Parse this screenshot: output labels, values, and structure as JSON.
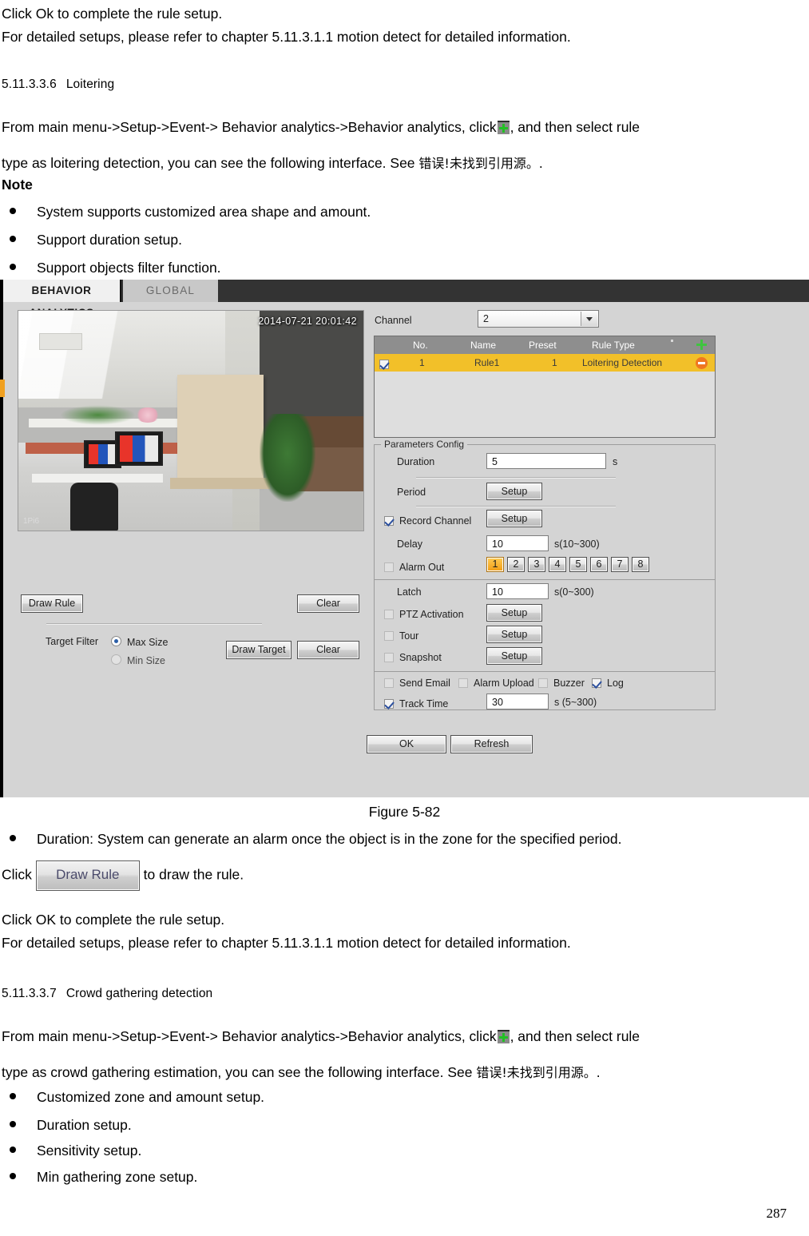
{
  "document": {
    "intro_lines": [
      "Click Ok to complete the rule setup.",
      "For detailed setups, please refer to chapter 5.11.3.1.1 motion detect for detailed information."
    ],
    "section1": {
      "number": "5.11.3.3.6",
      "title": "Loitering",
      "para_part1": "From main menu->Setup->Event-> Behavior analytics->Behavior analytics, click",
      "para_part2": ", and then select rule",
      "para_line2_a": "type as loitering detection, you can see the following interface. See ",
      "para_line2_cn": "错误!未找到引用源。",
      "para_line2_b": ".",
      "note_label": "Note",
      "bullets": [
        "System supports customized area shape and amount.",
        "Support duration setup.",
        "Support objects filter function."
      ]
    },
    "figure_caption": "Figure 5-82",
    "after_figure": {
      "bullet": "Duration: System can generate an alarm once the object is in the zone for the specified period.",
      "click_prefix": "Click",
      "inline_button": "Draw Rule",
      "click_suffix": "to draw the rule.",
      "lines": [
        "Click OK to complete the rule setup.",
        "For detailed setups, please refer to chapter 5.11.3.1.1 motion detect for detailed information."
      ]
    },
    "section2": {
      "number": "5.11.3.3.7",
      "title": "Crowd gathering detection",
      "para_part1": "From main menu->Setup->Event-> Behavior analytics->Behavior analytics, click",
      "para_part2": ", and then select rule",
      "para_line2_a": "type as crowd gathering estimation, you can see the following interface. See ",
      "para_line2_cn": "错误!未找到引用源。",
      "para_line2_b": ".",
      "bullets": [
        "Customized zone and amount setup.",
        "Duration setup.",
        "Sensitivity setup.",
        "Min gathering zone setup."
      ]
    },
    "page_number": "287"
  },
  "ui": {
    "tabs": [
      {
        "label": "BEHAVIOR ANALYTICS",
        "active": true
      },
      {
        "label": "GLOBAL",
        "active": false
      }
    ],
    "video": {
      "timestamp": "2014-07-21 20:01:42",
      "osd": "1Pi6"
    },
    "draw_panel": {
      "draw_rule_button": "Draw Rule",
      "clear_button_1": "Clear",
      "target_filter_label": "Target Filter",
      "max_size_label": "Max Size",
      "min_size_label": "Min Size",
      "max_size_selected": true,
      "draw_target_button": "Draw Target",
      "clear_button_2": "Clear"
    },
    "channel": {
      "label": "Channel",
      "value": "2"
    },
    "rule_table": {
      "columns": [
        "No.",
        "Name",
        "Preset",
        "Rule Type"
      ],
      "add_icon": "plus-icon",
      "rows": [
        {
          "enabled": true,
          "no": "1",
          "name": "Rule1",
          "preset": "1",
          "rule_type": "Loitering Detection",
          "delete_icon": "minus-icon"
        }
      ]
    },
    "parameters": {
      "legend": "Parameters Config",
      "duration": {
        "label": "Duration",
        "value": "5",
        "unit": "s"
      },
      "period": {
        "label": "Period",
        "button": "Setup"
      },
      "record_channel": {
        "label": "Record Channel",
        "checked": true,
        "button": "Setup"
      },
      "delay": {
        "label": "Delay",
        "value": "10",
        "unit": "s(10~300)"
      },
      "alarm_out": {
        "label": "Alarm Out",
        "checked": false,
        "buttons": [
          "1",
          "2",
          "3",
          "4",
          "5",
          "6",
          "7",
          "8"
        ],
        "active": "1"
      },
      "latch": {
        "label": "Latch",
        "value": "10",
        "unit": "s(0~300)"
      },
      "ptz_activation": {
        "label": "PTZ Activation",
        "checked": false,
        "button": "Setup"
      },
      "tour": {
        "label": "Tour",
        "checked": false,
        "button": "Setup"
      },
      "snapshot": {
        "label": "Snapshot",
        "checked": false,
        "button": "Setup"
      },
      "send_email": {
        "label": "Send Email",
        "checked": false
      },
      "alarm_upload": {
        "label": "Alarm Upload",
        "checked": false
      },
      "buzzer": {
        "label": "Buzzer",
        "checked": false
      },
      "log": {
        "label": "Log",
        "checked": true
      },
      "track_time": {
        "label": "Track Time",
        "checked": true,
        "value": "30",
        "unit": "s (5~300)"
      }
    },
    "footer": {
      "ok_button": "OK",
      "refresh_button": "Refresh"
    },
    "colors": {
      "header_bar": "#333333",
      "panel_bg": "#d4d4d4",
      "row_highlight": "#f2c029",
      "accent_orange": "#ef7721",
      "accent_green": "#3fc43f"
    }
  }
}
